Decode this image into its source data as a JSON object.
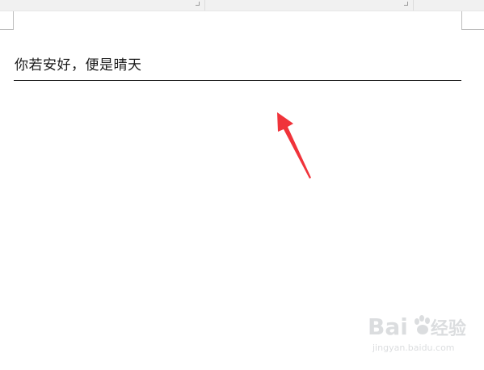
{
  "document": {
    "header_text": "你若安好，便是晴天"
  },
  "watermark": {
    "brand_left": "Bai",
    "brand_right": "经验",
    "site": "jingyan.baidu.com"
  },
  "colors": {
    "annotation_arrow": "#f0333a",
    "header_rule": "#000000",
    "top_strip": "#f1f1f1"
  }
}
